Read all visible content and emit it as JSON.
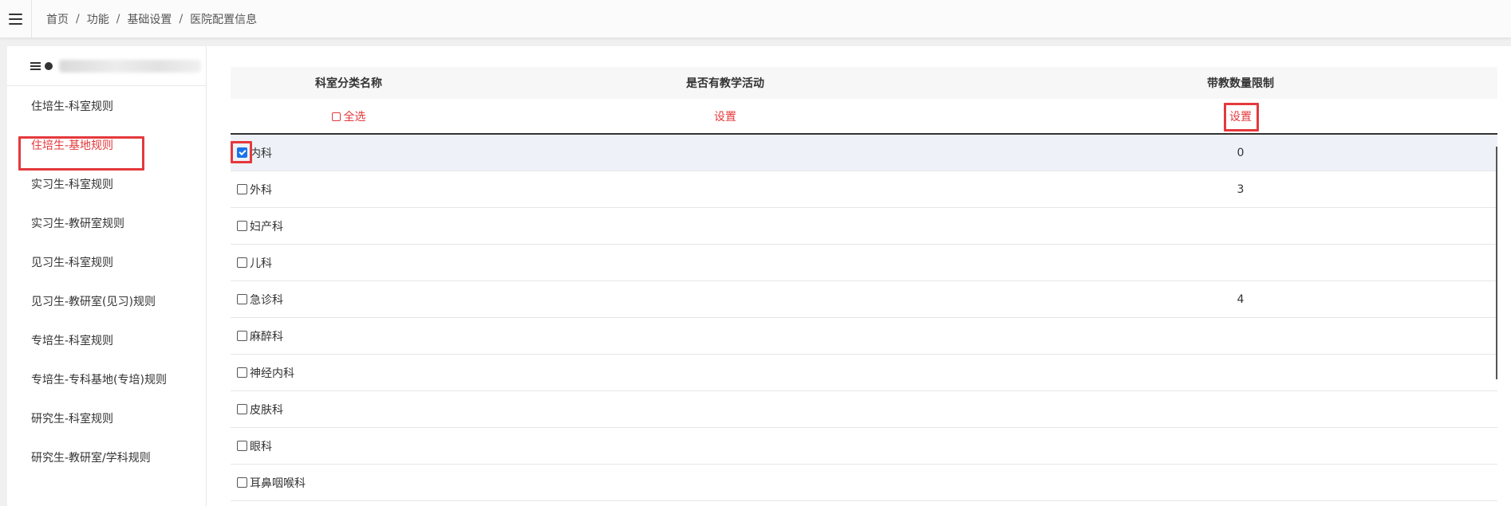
{
  "breadcrumb": {
    "items": [
      "首页",
      "功能",
      "基础设置",
      "医院配置信息"
    ],
    "separator": "/"
  },
  "sidebar": {
    "items": [
      {
        "label": "住培生-科室规则",
        "active": false
      },
      {
        "label": "住培生-基地规则",
        "active": true
      },
      {
        "label": "实习生-科室规则",
        "active": false
      },
      {
        "label": "实习生-教研室规则",
        "active": false
      },
      {
        "label": "见习生-科室规则",
        "active": false
      },
      {
        "label": "见习生-教研室(见习)规则",
        "active": false
      },
      {
        "label": "专培生-科室规则",
        "active": false
      },
      {
        "label": "专培生-专科基地(专培)规则",
        "active": false
      },
      {
        "label": "研究生-科室规则",
        "active": false
      },
      {
        "label": "研究生-教研室/学科规则",
        "active": false
      }
    ]
  },
  "table": {
    "headers": [
      "科室分类名称",
      "是否有教学活动",
      "带教数量限制"
    ],
    "select_all_label": "全选",
    "set_teaching_label": "设置",
    "set_limit_label": "设置",
    "rows": [
      {
        "name": "内科",
        "checked": true,
        "limit": "0"
      },
      {
        "name": "外科",
        "checked": false,
        "limit": "3"
      },
      {
        "name": "妇产科",
        "checked": false,
        "limit": ""
      },
      {
        "name": "儿科",
        "checked": false,
        "limit": ""
      },
      {
        "name": "急诊科",
        "checked": false,
        "limit": "4"
      },
      {
        "name": "麻醉科",
        "checked": false,
        "limit": ""
      },
      {
        "name": "神经内科",
        "checked": false,
        "limit": ""
      },
      {
        "name": "皮肤科",
        "checked": false,
        "limit": ""
      },
      {
        "name": "眼科",
        "checked": false,
        "limit": ""
      },
      {
        "name": "耳鼻咽喉科",
        "checked": false,
        "limit": ""
      }
    ]
  },
  "colors": {
    "accent_red": "#e4393c",
    "checkbox_blue": "#1a73e8",
    "selected_row": "#eef2f8"
  },
  "icons": {
    "menu": "hamburger-icon",
    "tree": "tree-icon",
    "checkbox": "checkbox-icon"
  }
}
